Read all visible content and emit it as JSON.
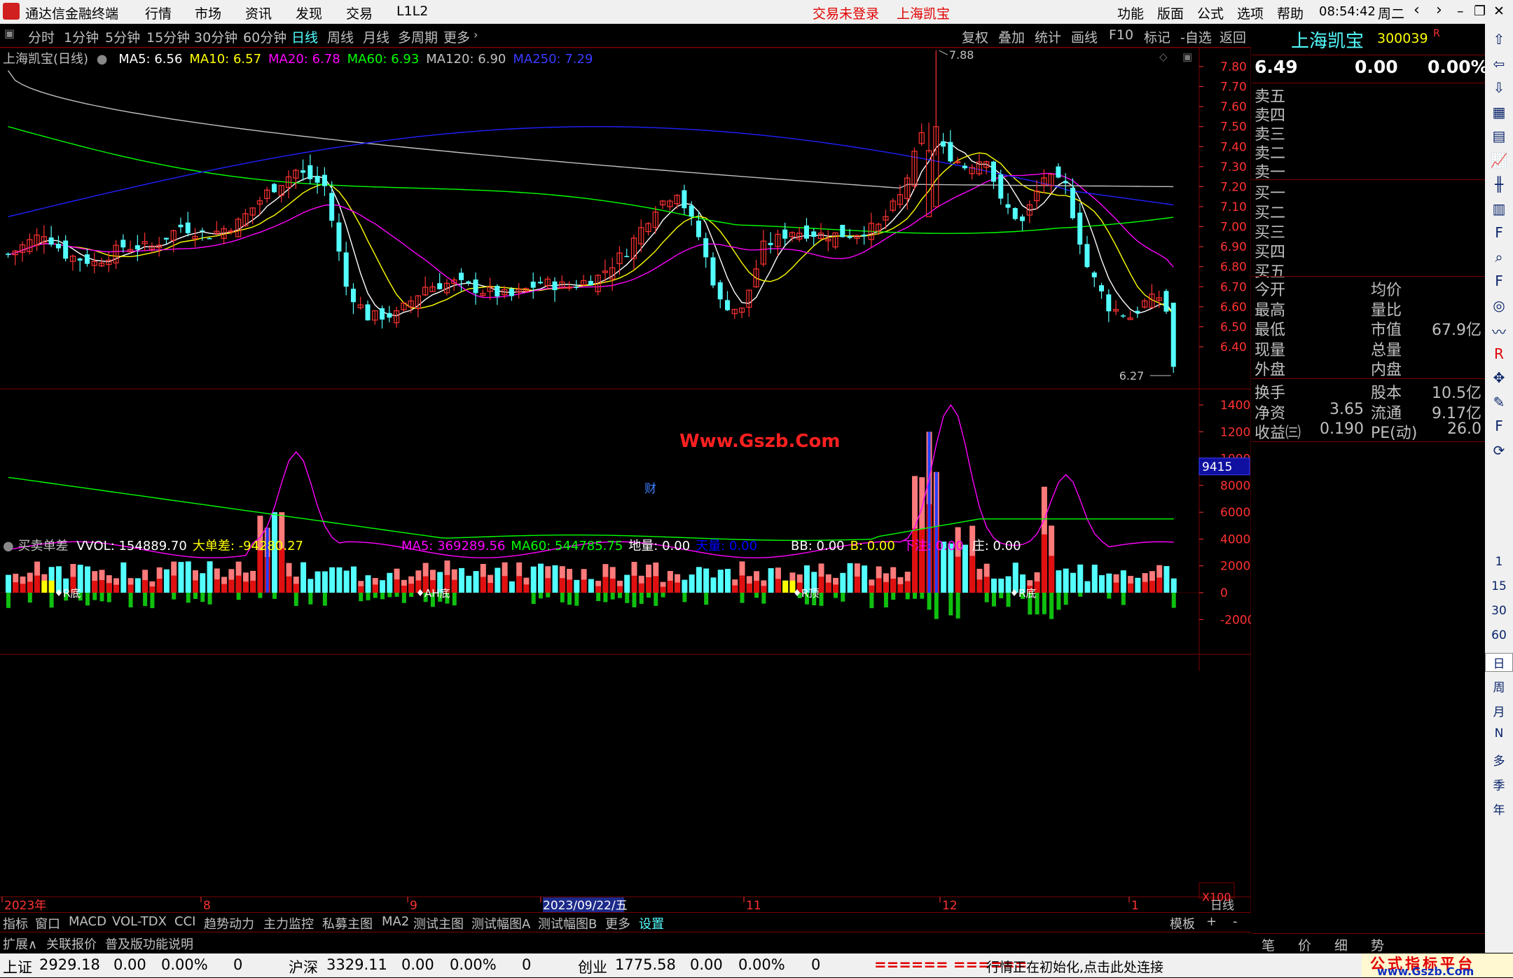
{
  "titlebar": {
    "app_name": "通达信金融终端",
    "menus": [
      "行情",
      "市场",
      "资讯",
      "发现",
      "交易",
      "L1L2"
    ],
    "trade_status": "交易未登录",
    "stock_name": "上海凯宝",
    "right_menus": [
      "功能",
      "版面",
      "公式",
      "选项",
      "帮助"
    ],
    "time": "08:54:42",
    "weekday": "周二"
  },
  "periods": {
    "items": [
      "分时",
      "1分钟",
      "5分钟",
      "15分钟",
      "30分钟",
      "60分钟",
      "日线",
      "周线",
      "月线",
      "多周期",
      "更多"
    ],
    "active": "日线",
    "right_items": [
      "复权",
      "叠加",
      "统计",
      "画线",
      "F10",
      "标记",
      "-自选",
      "返回"
    ]
  },
  "main_chart": {
    "header_title": "上海凯宝(日线)",
    "indicators": [
      {
        "label": "MA5: 6.56",
        "color": "#ffffff"
      },
      {
        "label": "MA10: 6.57",
        "color": "#ffff00"
      },
      {
        "label": "MA20: 6.78",
        "color": "#ff00ff"
      },
      {
        "label": "MA60: 6.93",
        "color": "#00ff00"
      },
      {
        "label": "MA120: 6.90",
        "color": "#c0c0c0"
      },
      {
        "label": "MA250: 7.29",
        "color": "#3a3aff"
      }
    ],
    "price_axis": [
      "7.80",
      "7.70",
      "7.60",
      "7.50",
      "7.40",
      "7.30",
      "7.20",
      "7.10",
      "7.00",
      "6.90",
      "6.80",
      "6.70",
      "6.60",
      "6.50",
      "6.40"
    ],
    "high_label": "7.88",
    "low_label": "6.27",
    "watermark": "Www.Gszb.Com",
    "finance_marker": "财"
  },
  "sub_chart": {
    "title": "买卖单差",
    "indicators": [
      {
        "label": "VVOL: 154889.70",
        "color": "#ffffff"
      },
      {
        "label": "大单差: -94280.27",
        "color": "#ffff00"
      },
      {
        "label": "MA5: 369289.56",
        "color": "#ff00ff"
      },
      {
        "label": "MA60: 544785.75",
        "color": "#00ff00"
      },
      {
        "label": "地量: 0.00",
        "color": "#ffffff"
      },
      {
        "label": "天量: 0.00",
        "color": "#0000ff"
      },
      {
        "label": "BB: 0.00",
        "color": "#ffffff"
      },
      {
        "label": "B: 0.00",
        "color": "#ffff00"
      },
      {
        "label": "下注: 0.00",
        "color": "#ff00ff"
      },
      {
        "label": "庄: 0.00",
        "color": "#ffffff"
      }
    ],
    "axis": [
      "14000",
      "12000",
      "10000",
      "8000",
      "6000",
      "4000",
      "2000",
      "0",
      "-2000"
    ],
    "axis_cursor_value": "9415",
    "axis_unit": "X100",
    "signals": [
      "R底",
      "AH底",
      "R顶",
      "R底"
    ]
  },
  "date_axis": {
    "labels": [
      "2023年",
      "8",
      "9",
      "2023/09/22/五",
      "11",
      "12",
      "1"
    ],
    "period": "日线"
  },
  "bottom_tabs": {
    "items": [
      "指标",
      "窗口",
      "MACD",
      "VOL-TDX",
      "CCI",
      "趋势动力",
      "主力监控",
      "私募主图",
      "MA2",
      "测试主图",
      "测试幅图A",
      "测试幅图B",
      "更多",
      "设置"
    ],
    "right_items": [
      "模板",
      "+",
      "-"
    ]
  },
  "bottom_bar2": {
    "items": [
      "扩展∧",
      "关联报价",
      "普及版功能说明"
    ]
  },
  "quote_panel": {
    "name": "上海凯宝",
    "code": "300039",
    "flag": "R",
    "price": "6.49",
    "change": "0.00",
    "change_pct": "0.00%",
    "sell_levels": [
      "卖五",
      "卖四",
      "卖三",
      "卖二",
      "卖一"
    ],
    "buy_levels": [
      "买一",
      "买二",
      "买三",
      "买四",
      "买五"
    ],
    "stats": [
      {
        "l1": "今开",
        "v1": "",
        "l2": "均价",
        "v2": ""
      },
      {
        "l1": "最高",
        "v1": "",
        "l2": "量比",
        "v2": ""
      },
      {
        "l1": "最低",
        "v1": "",
        "l2": "市值",
        "v2": "67.9亿"
      },
      {
        "l1": "现量",
        "v1": "",
        "l2": "总量",
        "v2": ""
      },
      {
        "l1": "外盘",
        "v1": "",
        "l2": "内盘",
        "v2": ""
      }
    ],
    "fund": [
      {
        "l1": "换手",
        "v1": "",
        "l2": "股本",
        "v2": "10.5亿"
      },
      {
        "l1": "净资",
        "v1": "3.65",
        "l2": "流通",
        "v2": "9.17亿"
      },
      {
        "l1": "收益㈢",
        "v1": "0.190",
        "l2": "PE(动)",
        "v2": "26.0"
      }
    ],
    "tabs": [
      "笔",
      "价",
      "细",
      "势"
    ]
  },
  "toolbar": {
    "icons": [
      "arrow-up-icon",
      "arrow-left-icon",
      "arrow-down-icon",
      "grid-icon",
      "table-icon",
      "line-chart-icon",
      "kline-icon",
      "report-icon",
      "f10-icon",
      "search-icon",
      "f12-icon",
      "circle-icon",
      "rsi-chart-icon",
      "rsi-icon",
      "move-icon",
      "pen-icon",
      "f5-icon",
      "refresh-icon"
    ],
    "periods": [
      "1",
      "15",
      "30",
      "60",
      "日",
      "周",
      "月",
      "N",
      "多",
      "季",
      "年"
    ]
  },
  "statusbar": {
    "indices": [
      {
        "name": "上证",
        "value": "2929.18",
        "change": "0.00",
        "pct": "0.00%",
        "vol": "0"
      },
      {
        "name": "沪深",
        "value": "3329.11",
        "change": "0.00",
        "pct": "0.00%",
        "vol": "0"
      },
      {
        "name": "创业",
        "value": "1775.58",
        "change": "0.00",
        "pct": "0.00%",
        "vol": "0"
      }
    ],
    "marquee": "====== ======",
    "message": "行情正在初始化,点击此处连接",
    "brand_line1": "公式指标平台",
    "brand_line2": "www.Gszb.Com"
  },
  "colors": {
    "up": "#ff3232",
    "down": "#54ffff",
    "ma5": "#ffffff",
    "ma10": "#ffff00",
    "ma20": "#ff00ff",
    "ma60": "#00ff00",
    "ma120": "#c0c0c0",
    "ma250": "#2020ff",
    "grid": "#7a0000",
    "axis_text": "#ff3232"
  }
}
